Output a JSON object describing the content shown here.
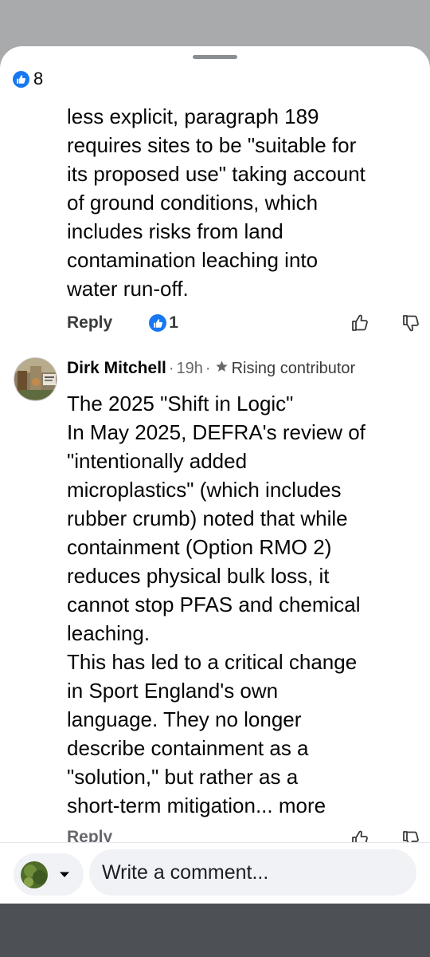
{
  "sheet": {
    "reaction_icon": "like-icon",
    "reaction_count": "8"
  },
  "comment_1": {
    "text": "less explicit, paragraph 189\nrequires sites to be \"suitable for\nits proposed use\" taking account\nof ground conditions, which\nincludes risks from land\ncontamination leaching into\nwater run-off.",
    "reply_label": "Reply",
    "like_count": "1"
  },
  "comment_2": {
    "author": "Dirk Mitchell",
    "time": "19h",
    "dot": "·",
    "badge_icon": "star-icon",
    "badge_label": "Rising contributor",
    "text": "The 2025 \"Shift in Logic\"\nIn May 2025, DEFRA's review of\n\"intentionally added\nmicroplastics\" (which includes\nrubber crumb) noted that while\ncontainment (Option RMO 2)\nreduces physical bulk loss, it\ncannot stop PFAS and chemical\nleaching.\nThis has led to a critical change\nin Sport England's own\nlanguage. They no longer\ndescribe containment as a\n\"solution,\" but rather as a\nshort-term mitigation...",
    "more_label": "more",
    "reply_label": "Reply"
  },
  "composer": {
    "placeholder": "Write a comment..."
  },
  "colors": {
    "like_blue": "#1877f2",
    "secondary_text": "#65676b",
    "primary_text": "#050505"
  }
}
